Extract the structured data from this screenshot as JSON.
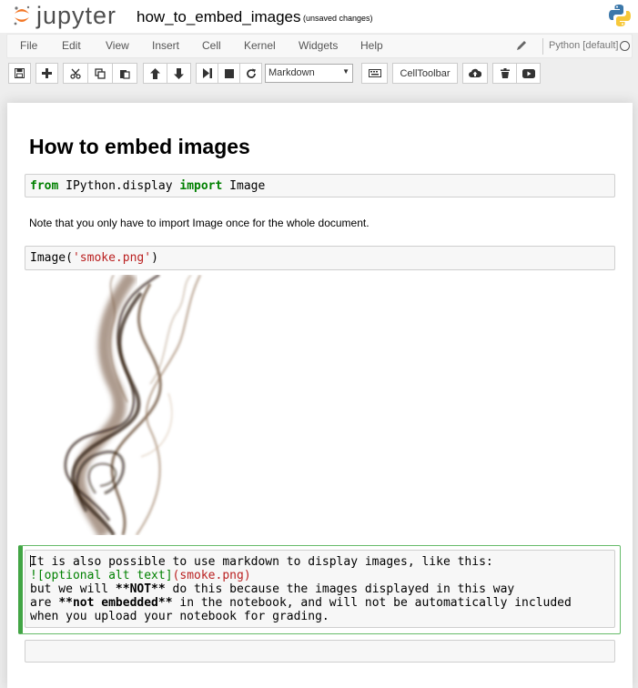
{
  "header": {
    "logo_text": "jupyter",
    "notebook_name": "how_to_embed_images",
    "save_status": "(unsaved changes)"
  },
  "menubar": {
    "items": [
      "File",
      "Edit",
      "View",
      "Insert",
      "Cell",
      "Kernel",
      "Widgets",
      "Help"
    ],
    "kernel_name": "Python [default]"
  },
  "toolbar": {
    "buttons": [
      "save-icon",
      "plus-icon",
      "cut-icon",
      "copy-icon",
      "paste-icon",
      "arrow-up-icon",
      "arrow-down-icon",
      "step-forward-icon",
      "stop-icon",
      "refresh-icon",
      "keyboard-icon",
      "cloud-upload-icon",
      "trash-icon",
      "youtube-play-icon"
    ],
    "cell_type": "Markdown",
    "celltoolbar_label": "CellToolbar"
  },
  "notebook": {
    "heading": "How to embed images",
    "cell1": {
      "kw_from": "from",
      "module": " IPython.display ",
      "kw_import": "import",
      "name": " Image"
    },
    "note": "Note that you only have to import Image once for the whole document.",
    "cell2": {
      "func": "Image(",
      "arg": "'smoke.png'",
      "close": ")"
    },
    "markdown_source": {
      "line1": "It is also possible to use markdown to display images, like this:",
      "line2_link": "![optional alt text]",
      "line2_url": "(smoke.png)",
      "line3_pre": "but we will ",
      "line3_bold": "**NOT**",
      "line3_post": " do this because the images displayed in this way",
      "line4_pre": "are ",
      "line4_bold": "**not embedded**",
      "line4_post": " in the notebook, and will not be automatically included",
      "line5": "when you upload your notebook for grading."
    }
  },
  "colors": {
    "selected_cell_border": "#42a545",
    "code_keyword": "#008000",
    "code_string": "#ba2121"
  }
}
